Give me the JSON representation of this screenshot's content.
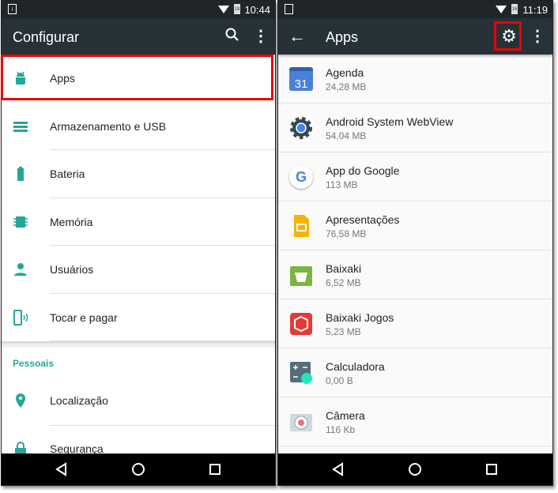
{
  "left": {
    "status": {
      "time": "10:44",
      "battery": "18"
    },
    "title": "Configurar",
    "items": [
      {
        "label": "Apps",
        "icon": "android-icon"
      },
      {
        "label": "Armazenamento e USB",
        "icon": "storage-icon"
      },
      {
        "label": "Bateria",
        "icon": "battery-icon"
      },
      {
        "label": "Memória",
        "icon": "memory-icon"
      },
      {
        "label": "Usuários",
        "icon": "person-icon"
      },
      {
        "label": "Tocar e pagar",
        "icon": "tap-pay-icon"
      }
    ],
    "section": "Pessoais",
    "items2": [
      {
        "label": "Localização",
        "icon": "location-icon"
      },
      {
        "label": "Segurança",
        "icon": "lock-icon"
      }
    ]
  },
  "right": {
    "status": {
      "time": "11:19",
      "battery": "16"
    },
    "title": "Apps",
    "apps": [
      {
        "name": "Agenda",
        "size": "24,28 MB",
        "icon_text": "31"
      },
      {
        "name": "Android System WebView",
        "size": "54,04 MB"
      },
      {
        "name": "App do Google",
        "size": "113 MB",
        "icon_text": "G"
      },
      {
        "name": "Apresentações",
        "size": "76,58 MB"
      },
      {
        "name": "Baixaki",
        "size": "6,52 MB"
      },
      {
        "name": "Baixaki Jogos",
        "size": "5,23 MB"
      },
      {
        "name": "Calculadora",
        "size": "0,00 B"
      },
      {
        "name": "Câmera",
        "size": "116 Kb"
      }
    ]
  },
  "colors": {
    "accent": "#26a69a",
    "toolbar": "#263238",
    "highlight": "#e00000"
  }
}
